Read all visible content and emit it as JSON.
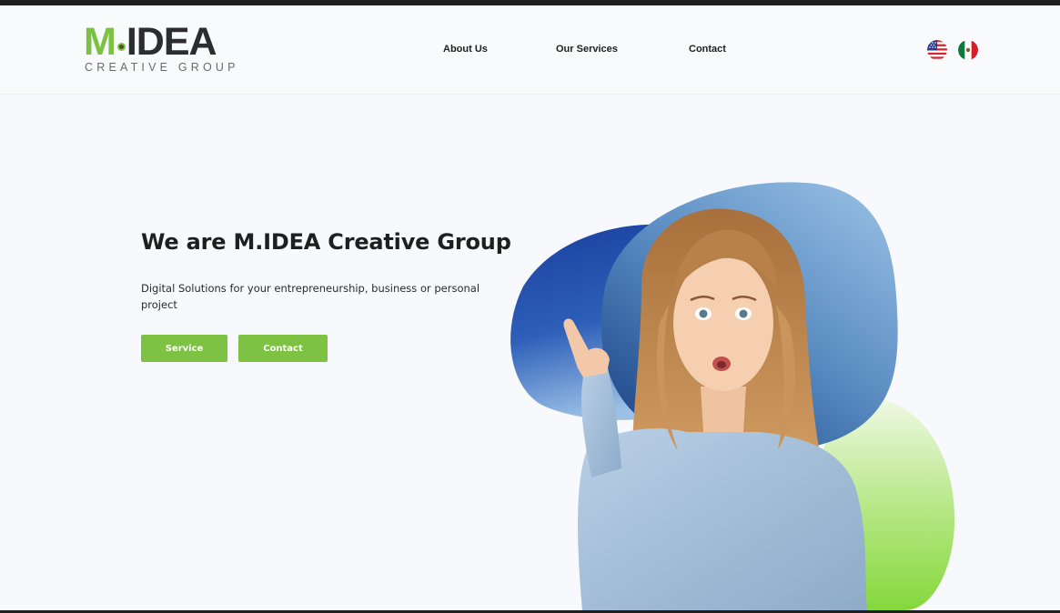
{
  "brand": {
    "logo_main_m": "M",
    "logo_main_idea": "IDEA",
    "logo_sub": "CREATIVE GROUP",
    "accent_color": "#7dc242",
    "dark_color": "#2d2d2d"
  },
  "nav": {
    "items": [
      {
        "label": "About Us"
      },
      {
        "label": "Our Services"
      },
      {
        "label": "Contact"
      }
    ]
  },
  "languages": [
    {
      "icon": "us-flag-icon"
    },
    {
      "icon": "mexico-flag-icon"
    }
  ],
  "hero": {
    "title": "We are M.IDEA Creative Group",
    "subtitle": "Digital Solutions for your entrepreneurship, business or personal project",
    "buttons": [
      {
        "label": "Service"
      },
      {
        "label": "Contact"
      }
    ],
    "blob_colors": {
      "blue_dark": "#1f48a8",
      "blue_light": "#8fb8dc",
      "green": "#8fdc4a"
    }
  }
}
